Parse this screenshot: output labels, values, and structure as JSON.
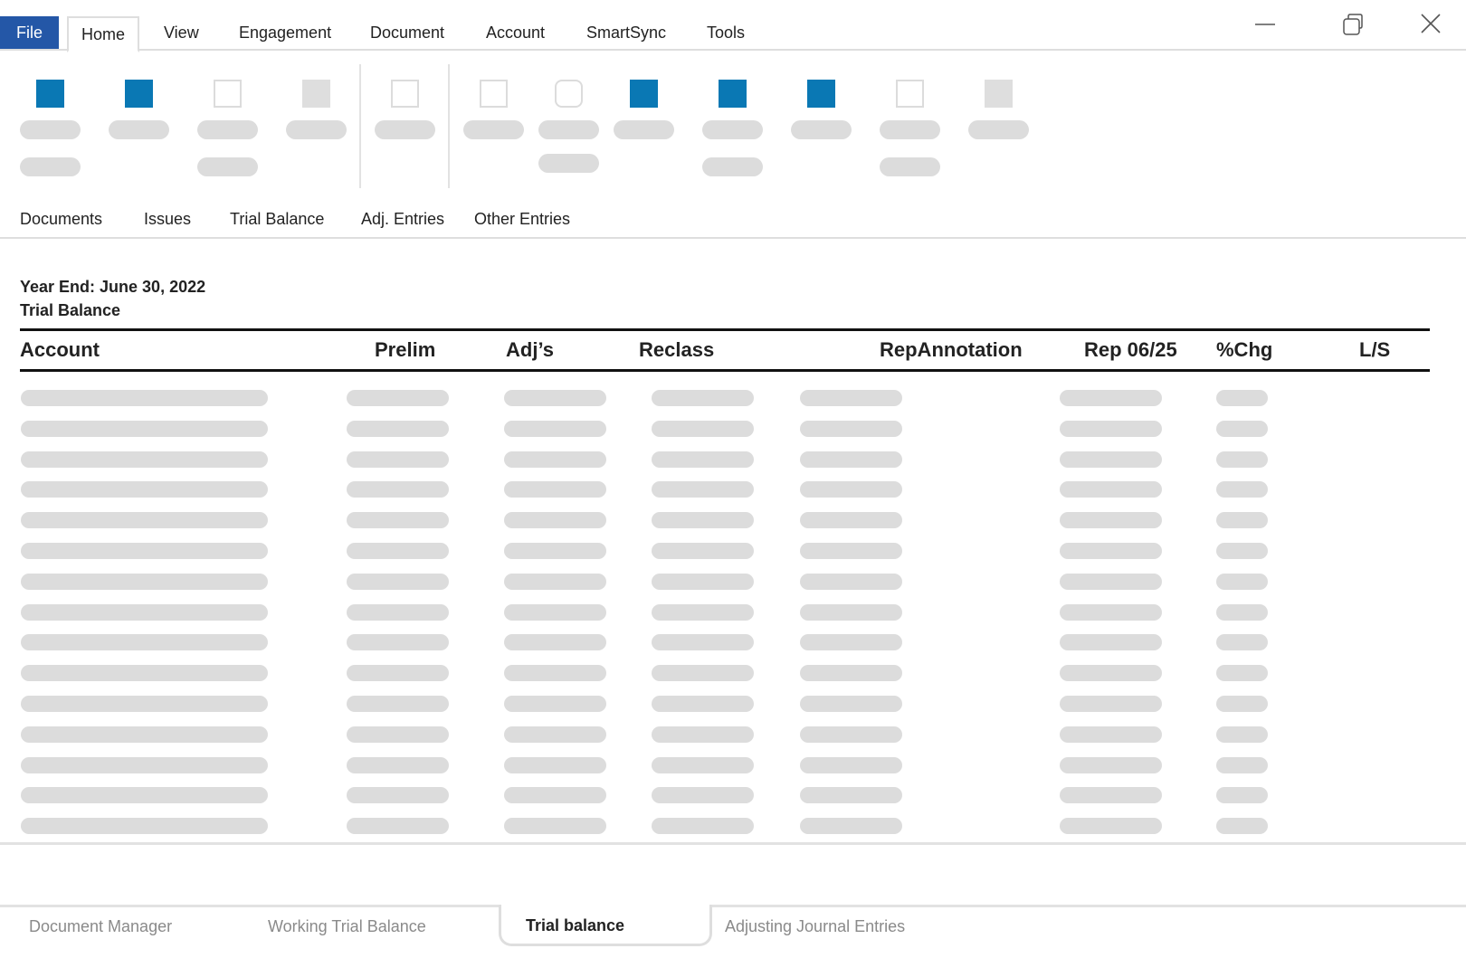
{
  "menu": {
    "file": "File",
    "home": "Home",
    "view": "View",
    "engagement": "Engagement",
    "document": "Document",
    "account": "Account",
    "smartsync": "SmartSync",
    "tools": "Tools"
  },
  "window_controls": {
    "minimize_icon": "minimize-icon",
    "restore_icon": "restore-icon",
    "close_icon": "close-icon"
  },
  "colors": {
    "file_menu": "#2457a7",
    "ribbon_icon_active": "#0a78b4",
    "placeholder": "#dcdcdc"
  },
  "section_tabs": {
    "documents": "Documents",
    "issues": "Issues",
    "trial_balance": "Trial Balance",
    "adj_entries": "Adj. Entries",
    "other_entries": "Other Entries"
  },
  "report": {
    "year_end": "Year End: June 30, 2022",
    "title": "Trial Balance"
  },
  "table": {
    "columns": {
      "account": "Account",
      "prelim": "Prelim",
      "adjs": "Adj’s",
      "reclass": "Reclass",
      "rep_annotation": "RepAnnotation",
      "rep_0625": "Rep 06/25",
      "pct_chg": "%Chg",
      "ls": "L/S"
    }
  },
  "sheet_tabs": {
    "document_manager": "Document Manager",
    "working_trial_balance": "Working Trial Balance",
    "trial_balance": "Trial balance",
    "adjusting_journal_entries": "Adjusting Journal Entries"
  }
}
